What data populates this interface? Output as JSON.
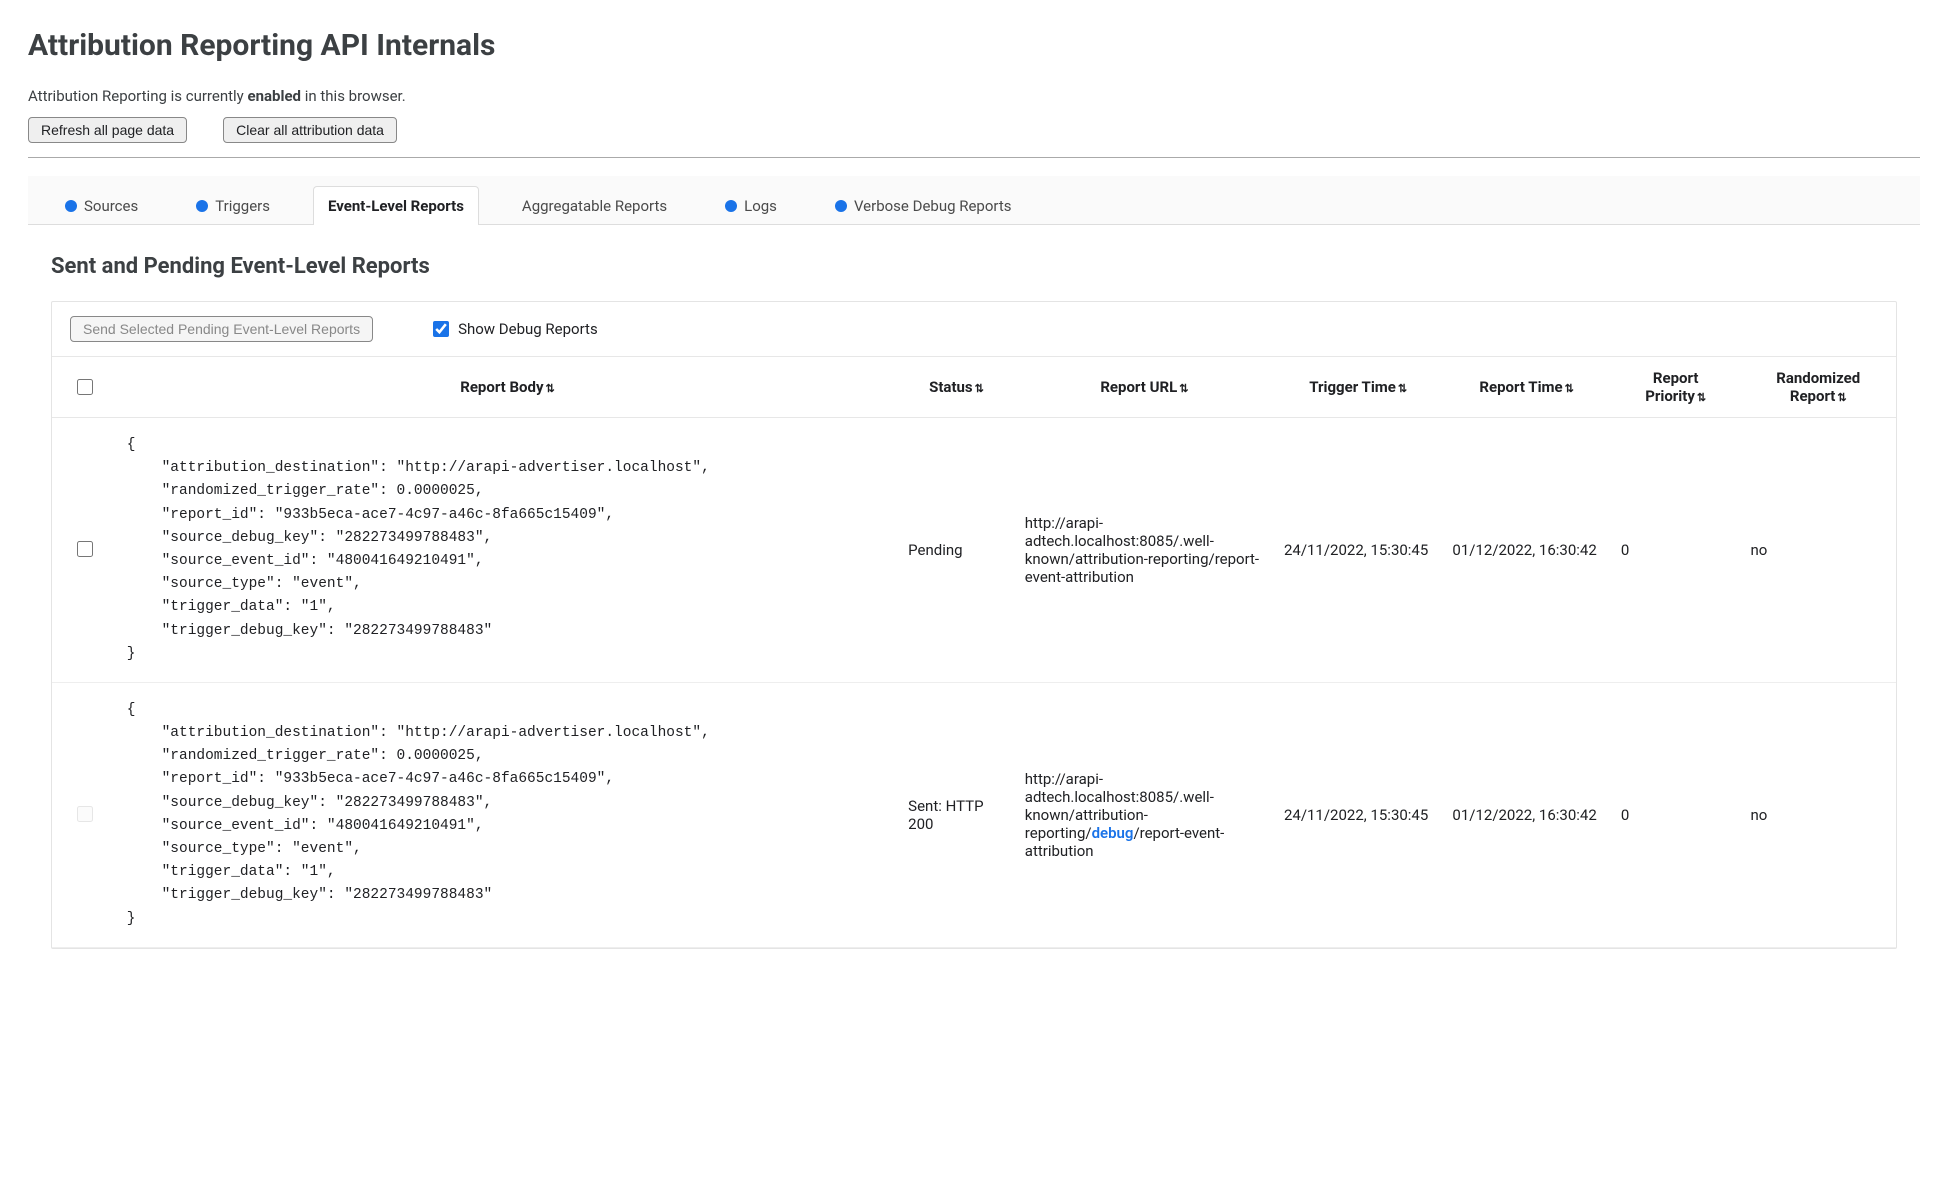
{
  "header": {
    "title": "Attribution Reporting API Internals",
    "status_prefix": "Attribution Reporting is currently ",
    "status_bold": "enabled",
    "status_suffix": " in this browser.",
    "refresh_btn": "Refresh all page data",
    "clear_btn": "Clear all attribution data"
  },
  "tabs": [
    {
      "label": "Sources",
      "dot": true,
      "active": false
    },
    {
      "label": "Triggers",
      "dot": true,
      "active": false
    },
    {
      "label": "Event-Level Reports",
      "dot": false,
      "active": true
    },
    {
      "label": "Aggregatable Reports",
      "dot": false,
      "active": false
    },
    {
      "label": "Logs",
      "dot": true,
      "active": false
    },
    {
      "label": "Verbose Debug Reports",
      "dot": true,
      "active": false
    }
  ],
  "panel": {
    "heading": "Sent and Pending Event-Level Reports",
    "send_btn": "Send Selected Pending Event-Level Reports",
    "show_debug_label": "Show Debug Reports"
  },
  "columns": {
    "body": "Report Body",
    "status": "Status",
    "url": "Report URL",
    "trigger_time": "Trigger Time",
    "report_time": "Report Time",
    "priority": "Report Priority",
    "randomized": "Randomized Report"
  },
  "rows": [
    {
      "checkbox_disabled": false,
      "body": "{\n    \"attribution_destination\": \"http://arapi-advertiser.localhost\",\n    \"randomized_trigger_rate\": 0.0000025,\n    \"report_id\": \"933b5eca-ace7-4c97-a46c-8fa665c15409\",\n    \"source_debug_key\": \"282273499788483\",\n    \"source_event_id\": \"480041649210491\",\n    \"source_type\": \"event\",\n    \"trigger_data\": \"1\",\n    \"trigger_debug_key\": \"282273499788483\"\n}",
      "status": "Pending",
      "url_plain": "http://arapi-adtech.localhost:8085/.well-known/attribution-reporting/report-event-attribution",
      "url_pre": "http://arapi-adtech.localhost:8085/.well-known/attribution-reporting/report-event-attribution",
      "url_highlight": "",
      "url_post": "",
      "trigger_time": "24/11/2022, 15:30:45",
      "report_time": "01/12/2022, 16:30:42",
      "priority": "0",
      "randomized": "no"
    },
    {
      "checkbox_disabled": true,
      "body": "{\n    \"attribution_destination\": \"http://arapi-advertiser.localhost\",\n    \"randomized_trigger_rate\": 0.0000025,\n    \"report_id\": \"933b5eca-ace7-4c97-a46c-8fa665c15409\",\n    \"source_debug_key\": \"282273499788483\",\n    \"source_event_id\": \"480041649210491\",\n    \"source_type\": \"event\",\n    \"trigger_data\": \"1\",\n    \"trigger_debug_key\": \"282273499788483\"\n}",
      "status": "Sent: HTTP 200",
      "url_plain": "http://arapi-adtech.localhost:8085/.well-known/attribution-reporting/debug/report-event-attribution",
      "url_pre": "http://arapi-adtech.localhost:8085/.well-known/attribution-reporting/",
      "url_highlight": "debug",
      "url_post": "/report-event-attribution",
      "trigger_time": "24/11/2022, 15:30:45",
      "report_time": "01/12/2022, 16:30:42",
      "priority": "0",
      "randomized": "no"
    }
  ]
}
